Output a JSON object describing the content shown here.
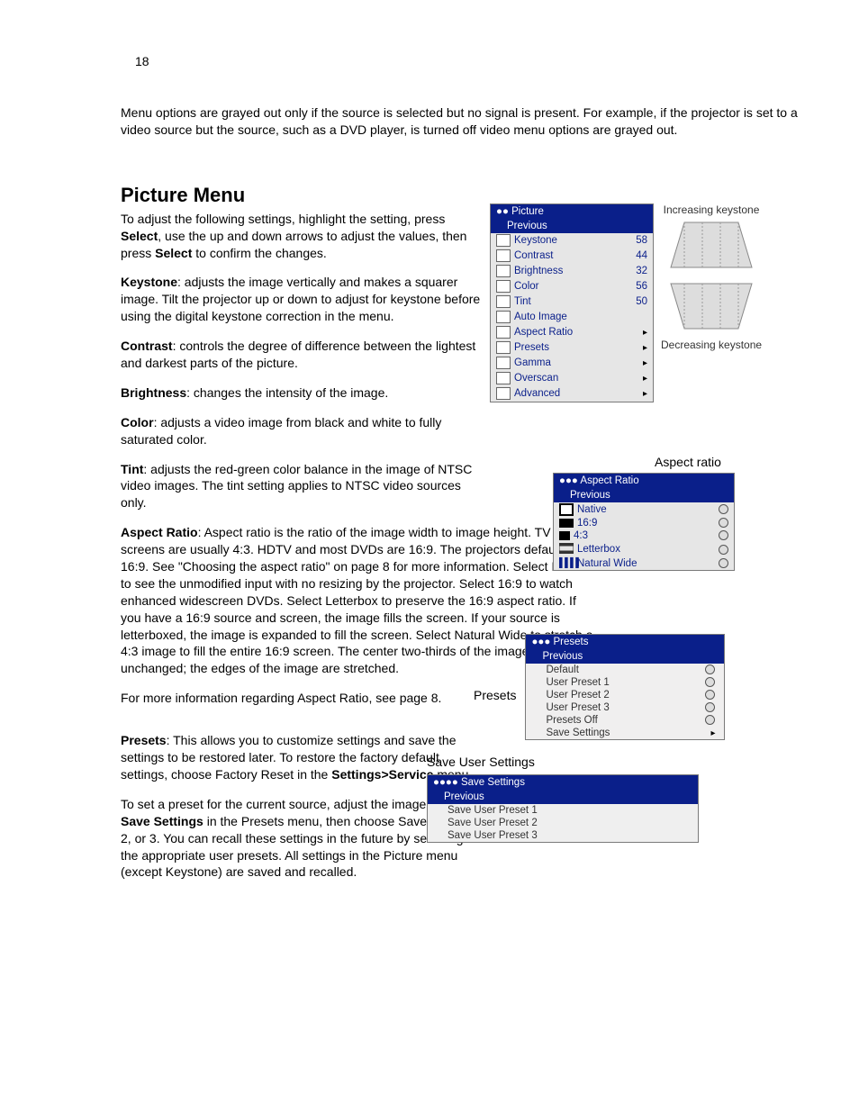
{
  "page_number": "18",
  "intro": "Menu options are grayed out only if the source is selected but no signal is present. For example, if the projector is set to a video source but the source, such as a DVD player, is turned off video menu options are grayed out.",
  "heading": "Picture Menu",
  "para_intro": "To adjust the following settings, highlight the setting, press ",
  "para_intro_b1": "Select",
  "para_intro_mid": ", use the up and down arrows to adjust the values, then press ",
  "para_intro_b2": "Select",
  "para_intro_end": " to confirm the changes.",
  "keystone_b": "Keystone",
  "keystone_t": ": adjusts the image vertically and makes a squarer image. Tilt the projector up or down to adjust for keystone before using the digital keystone correction in the menu.",
  "contrast_b": "Contrast",
  "contrast_t": ": controls the degree of difference between the lightest and darkest parts of the picture.",
  "brightness_b": "Brightness",
  "brightness_t": ": changes the intensity of the image.",
  "color_b": "Color",
  "color_t": ": adjusts a video image from black and white to fully saturated color.",
  "tint_b": "Tint",
  "tint_t": ": adjusts the red-green color balance in the image of NTSC video images. The tint setting applies to NTSC video sources only.",
  "aspect_b": "Aspect Ratio",
  "aspect_t": ": Aspect ratio is the ratio of the image width to image height. TV screens are usually 4:3. HDTV and most DVDs are 16:9. The projectors default is 16:9. See \"Choosing the aspect ratio\" on page 8 for more information. Select Native to see the unmodified input with no resizing by the projector. Select 16:9 to watch enhanced widescreen DVDs. Select Letterbox to preserve the 16:9 aspect ratio. If you have a 16:9 source and screen, the image fills the screen. If your source is letterboxed, the image is expanded to fill the screen. Select Natural Wide to stretch a 4:3 image to fill the entire 16:9 screen. The center two-thirds of the image is unchanged; the edges of the image are stretched.",
  "aspect_more": "For more information regarding Aspect Ratio, see page 8.",
  "presets_b": "Presets",
  "presets_t1": ": This allows you to customize settings and save the settings to be restored later. To restore the factory default settings, choose Factory Reset in the ",
  "presets_b2": "Settings>Service",
  "presets_t2": " menu.",
  "presets_para2a": "To set a preset for the current source, adjust the image, select ",
  "presets_para2b": "Save Settings",
  "presets_para2c": " in the Presets menu, then choose Save User 1, 2, or 3. You can recall these settings in the future by selecting the appropriate user presets. All settings in the Picture menu (except Keystone) are saved and recalled.",
  "keystone_inc_label": "Increasing keystone",
  "keystone_dec_label": "Decreasing keystone",
  "osd_picture": {
    "title": "●● Picture",
    "previous": "Previous",
    "rows": [
      {
        "label": "Keystone",
        "val": "58"
      },
      {
        "label": "Contrast",
        "val": "44"
      },
      {
        "label": "Brightness",
        "val": "32"
      },
      {
        "label": "Color",
        "val": "56"
      },
      {
        "label": "Tint",
        "val": "50"
      },
      {
        "label": "Auto Image",
        "val": ""
      },
      {
        "label": "Aspect Ratio",
        "arrow": true
      },
      {
        "label": "Presets",
        "arrow": true
      },
      {
        "label": "Gamma",
        "arrow": true
      },
      {
        "label": "Overscan",
        "arrow": true
      },
      {
        "label": "Advanced",
        "arrow": true
      }
    ]
  },
  "aspect_caption": "Aspect ratio",
  "osd_aspect": {
    "title": "●●● Aspect Ratio",
    "previous": "Previous",
    "rows": [
      {
        "label": "Native"
      },
      {
        "label": "16:9"
      },
      {
        "label": "4:3"
      },
      {
        "label": "Letterbox"
      },
      {
        "label": "Natural Wide"
      }
    ]
  },
  "presets_caption": "Presets",
  "osd_presets": {
    "title": "●●● Presets",
    "previous": "Previous",
    "rows": [
      {
        "label": "Default",
        "radio": true
      },
      {
        "label": "User Preset 1",
        "radio": true
      },
      {
        "label": "User Preset 2",
        "radio": true
      },
      {
        "label": "User Preset 3",
        "radio": true
      },
      {
        "label": "Presets Off",
        "radio": true
      },
      {
        "label": "Save Settings",
        "arrow": true
      }
    ]
  },
  "save_caption": "Save User Settings",
  "osd_save": {
    "title": "●●●● Save Settings",
    "previous": "Previous",
    "rows": [
      {
        "label": "Save User Preset 1"
      },
      {
        "label": "Save User Preset 2"
      },
      {
        "label": "Save User Preset 3"
      }
    ]
  }
}
